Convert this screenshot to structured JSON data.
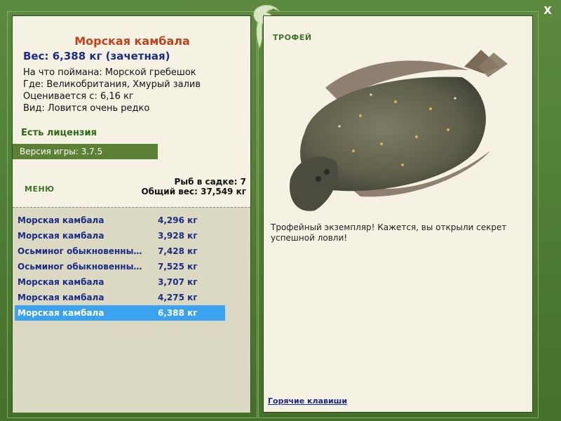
{
  "close_label": "X",
  "fish": {
    "title": "Морская камбала",
    "weight_line": "Вес: 6,388 кг (зачетная)",
    "caught_with": "На что поймана: Морской гребешок",
    "where": "Где: Великобритания, Хмурый залив",
    "rated_from": "Оценивается с: 6,16 кг",
    "rarity": "Вид: Ловится очень редко"
  },
  "license_text": "Есть лицензия",
  "version_text": "Версия игры: 3.7.5",
  "menu_label": "МЕНЮ",
  "cage": {
    "count": "Рыб в садке: 7",
    "total_weight": "Общий вес: 37,549 кг"
  },
  "catch_list": [
    {
      "name": "Морская камбала",
      "weight": "4,296 кг"
    },
    {
      "name": "Морская камбала",
      "weight": "3,928 кг"
    },
    {
      "name": "Осьминог обыкновенны…",
      "weight": "7,428 кг"
    },
    {
      "name": "Осьминог обыкновенны…",
      "weight": "7,525 кг"
    },
    {
      "name": "Морская камбала",
      "weight": "3,707 кг"
    },
    {
      "name": "Морская камбала",
      "weight": "4,275 кг"
    },
    {
      "name": "Морская камбала",
      "weight": "6,388 кг"
    }
  ],
  "selected_index": 6,
  "trophy_label": "ТРОФЕЙ",
  "trophy_text": "Трофейный экземпляр! Кажется, вы открыли секрет успешной ловли!",
  "hotkeys_label": "Горячие клавиши",
  "colors": {
    "frame_green": "#4f7a35",
    "panel_bg": "#f5f2e3",
    "title_orange": "#c0431c",
    "text_blue": "#1b2b86",
    "selected_bg": "#3aa2ef"
  }
}
